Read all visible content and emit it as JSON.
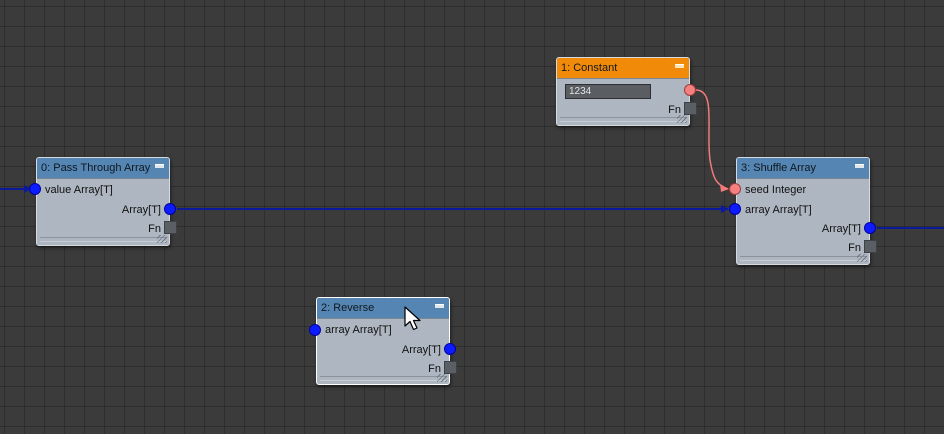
{
  "nodes": {
    "pass_through": {
      "title": "0: Pass Through Array",
      "input_label": "value Array[T]",
      "output_label": "Array[T]",
      "fn_label": "Fn"
    },
    "constant": {
      "title": "1: Constant",
      "value": "1234",
      "fn_label": "Fn"
    },
    "reverse": {
      "title": "2: Reverse",
      "input_label": "array Array[T]",
      "output_label": "Array[T]",
      "fn_label": "Fn"
    },
    "shuffle": {
      "title": "3: Shuffle Array",
      "seed_label": "seed Integer",
      "input_label": "array Array[T]",
      "output_label": "Array[T]",
      "fn_label": "Fn"
    }
  },
  "colors": {
    "canvas_background": "#3b3b3b",
    "node_body": "#aeb7c1",
    "header_blue": "#5585b2",
    "header_orange": "#f28a09",
    "array_pin": "#0d1cff",
    "integer_pin": "#f58080",
    "array_wire": "#0b1a9c",
    "integer_wire": "#f07a7a"
  },
  "icons": {
    "cursor": "mouse-pointer-icon",
    "collapse": "minimize-icon",
    "resize": "resize-grip-icon"
  }
}
